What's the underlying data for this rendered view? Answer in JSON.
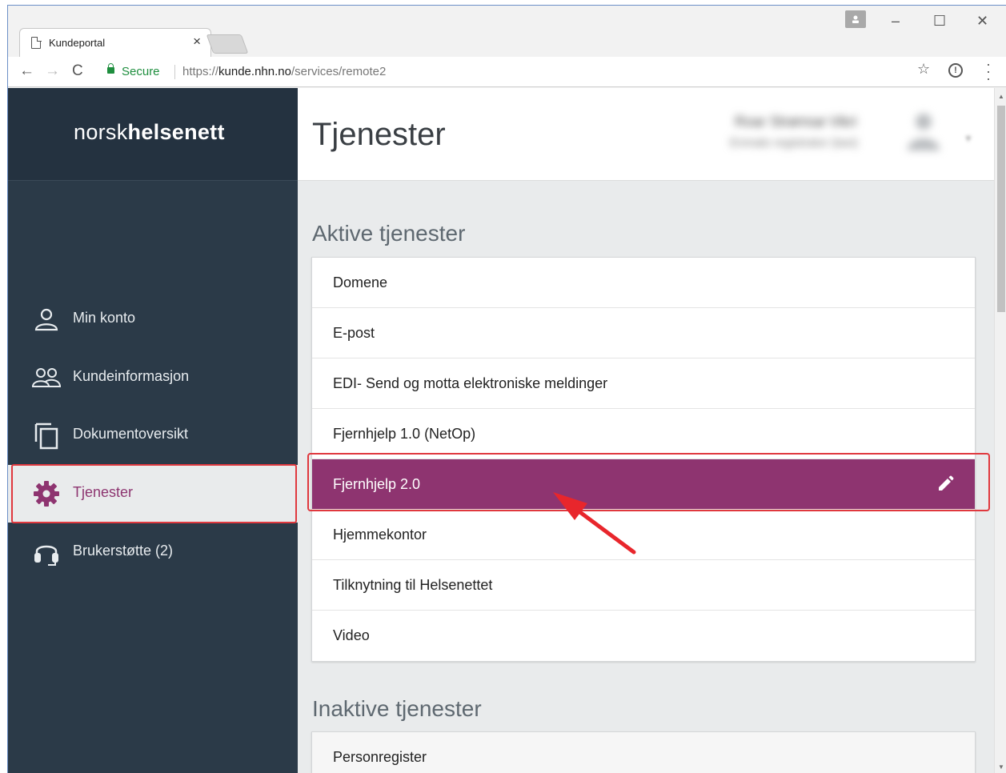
{
  "browser": {
    "tab_title": "Kundeportal",
    "tab_close": "×",
    "secure_label": "Secure",
    "url_prefix": "https://",
    "url_host": "kunde.nhn.no",
    "url_path": "/services/remote2",
    "window_controls": {
      "minimize": "–",
      "maximize": "☐",
      "close": "✕"
    }
  },
  "sidebar": {
    "brand_light": "norsk",
    "brand_bold": "helsenett",
    "items": [
      {
        "label": "Min konto",
        "icon": "user-icon"
      },
      {
        "label": "Kundeinformasjon",
        "icon": "users-icon"
      },
      {
        "label": "Dokumentoversikt",
        "icon": "documents-icon"
      },
      {
        "label": "Tjenester",
        "icon": "gear-icon",
        "active": true
      },
      {
        "label": "Brukerstøtte (2)",
        "icon": "headset-icon"
      }
    ]
  },
  "header": {
    "title": "Tjenester",
    "user_name": "Roar Strømsø Vikri",
    "user_role": "Enmalo registrator (taxi)"
  },
  "active_services": {
    "title": "Aktive tjenester",
    "items": [
      "Domene",
      "E-post",
      "EDI- Send og motta elektroniske meldinger",
      "Fjernhjelp 1.0 (NetOp)",
      "Fjernhjelp 2.0",
      "Hjemmekontor",
      "Tilknytning til Helsenettet",
      "Video"
    ],
    "selected": "Fjernhjelp 2.0"
  },
  "inactive_services": {
    "title": "Inaktive tjenester",
    "items": [
      "Personregister"
    ]
  },
  "colors": {
    "sidebar_bg": "#2b3a48",
    "accent": "#8e3470",
    "highlight": "#e0383e"
  }
}
